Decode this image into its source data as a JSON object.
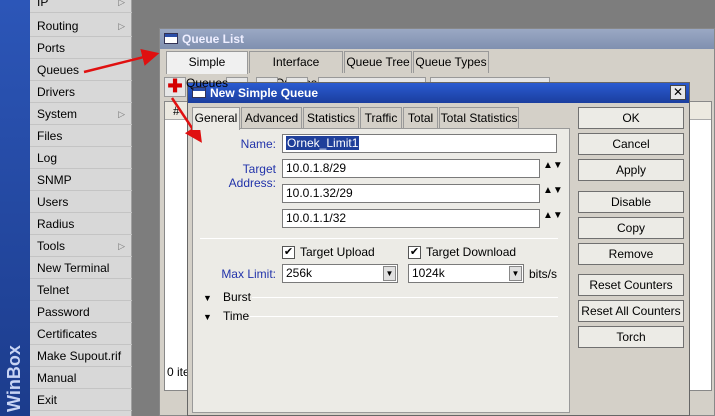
{
  "sidebar": {
    "brand": "WinBox",
    "items": [
      {
        "label": "IP",
        "submenu": true
      },
      {
        "label": "Routing",
        "submenu": true
      },
      {
        "label": "Ports",
        "submenu": false
      },
      {
        "label": "Queues",
        "submenu": false
      },
      {
        "label": "Drivers",
        "submenu": false
      },
      {
        "label": "System",
        "submenu": true
      },
      {
        "label": "Files",
        "submenu": false
      },
      {
        "label": "Log",
        "submenu": false
      },
      {
        "label": "SNMP",
        "submenu": false
      },
      {
        "label": "Users",
        "submenu": false
      },
      {
        "label": "Radius",
        "submenu": false
      },
      {
        "label": "Tools",
        "submenu": true
      },
      {
        "label": "New Terminal",
        "submenu": false
      },
      {
        "label": "Telnet",
        "submenu": false
      },
      {
        "label": "Password",
        "submenu": false
      },
      {
        "label": "Certificates",
        "submenu": false
      },
      {
        "label": "Make Supout.rif",
        "submenu": false
      },
      {
        "label": "Manual",
        "submenu": false
      },
      {
        "label": "Exit",
        "submenu": false
      }
    ],
    "submenu_glyph": "▷"
  },
  "queue_list": {
    "title": "Queue List",
    "tabs": [
      "Simple Queues",
      "Interface Queues",
      "Queue Tree",
      "Queue Types"
    ],
    "add_symbol": "✚",
    "column_hash": "#",
    "status": "0 ite"
  },
  "dialog": {
    "title": "New Simple Queue",
    "close_glyph": "✕",
    "tabs": [
      "General",
      "Advanced",
      "Statistics",
      "Traffic",
      "Total",
      "Total Statistics"
    ],
    "name_label": "Name:",
    "name_value": "Ornek_Limit1",
    "target_address_label": "Target Address:",
    "target_addresses": [
      "10.0.1.8/29",
      "10.0.1.32/29",
      "10.0.1.1/32"
    ],
    "spin_glyph": "▲▼",
    "target_upload_label": "Target Upload",
    "target_download_label": "Target Download",
    "check_glyph": "✔",
    "max_limit_label": "Max Limit:",
    "max_limit_upload": "256k",
    "max_limit_download": "1024k",
    "dropdown_glyph": "▼",
    "unit": "bits/s",
    "burst_label": "Burst",
    "time_label": "Time",
    "section_glyph": "▼",
    "buttons": [
      "OK",
      "Cancel",
      "Apply",
      "Disable",
      "Copy",
      "Remove",
      "Reset Counters",
      "Reset All Counters",
      "Torch"
    ]
  },
  "colors": {
    "annotation_arrow": "#e01010",
    "dialog_title_bg": "#2a5bd1",
    "field_label": "#2233aa"
  }
}
